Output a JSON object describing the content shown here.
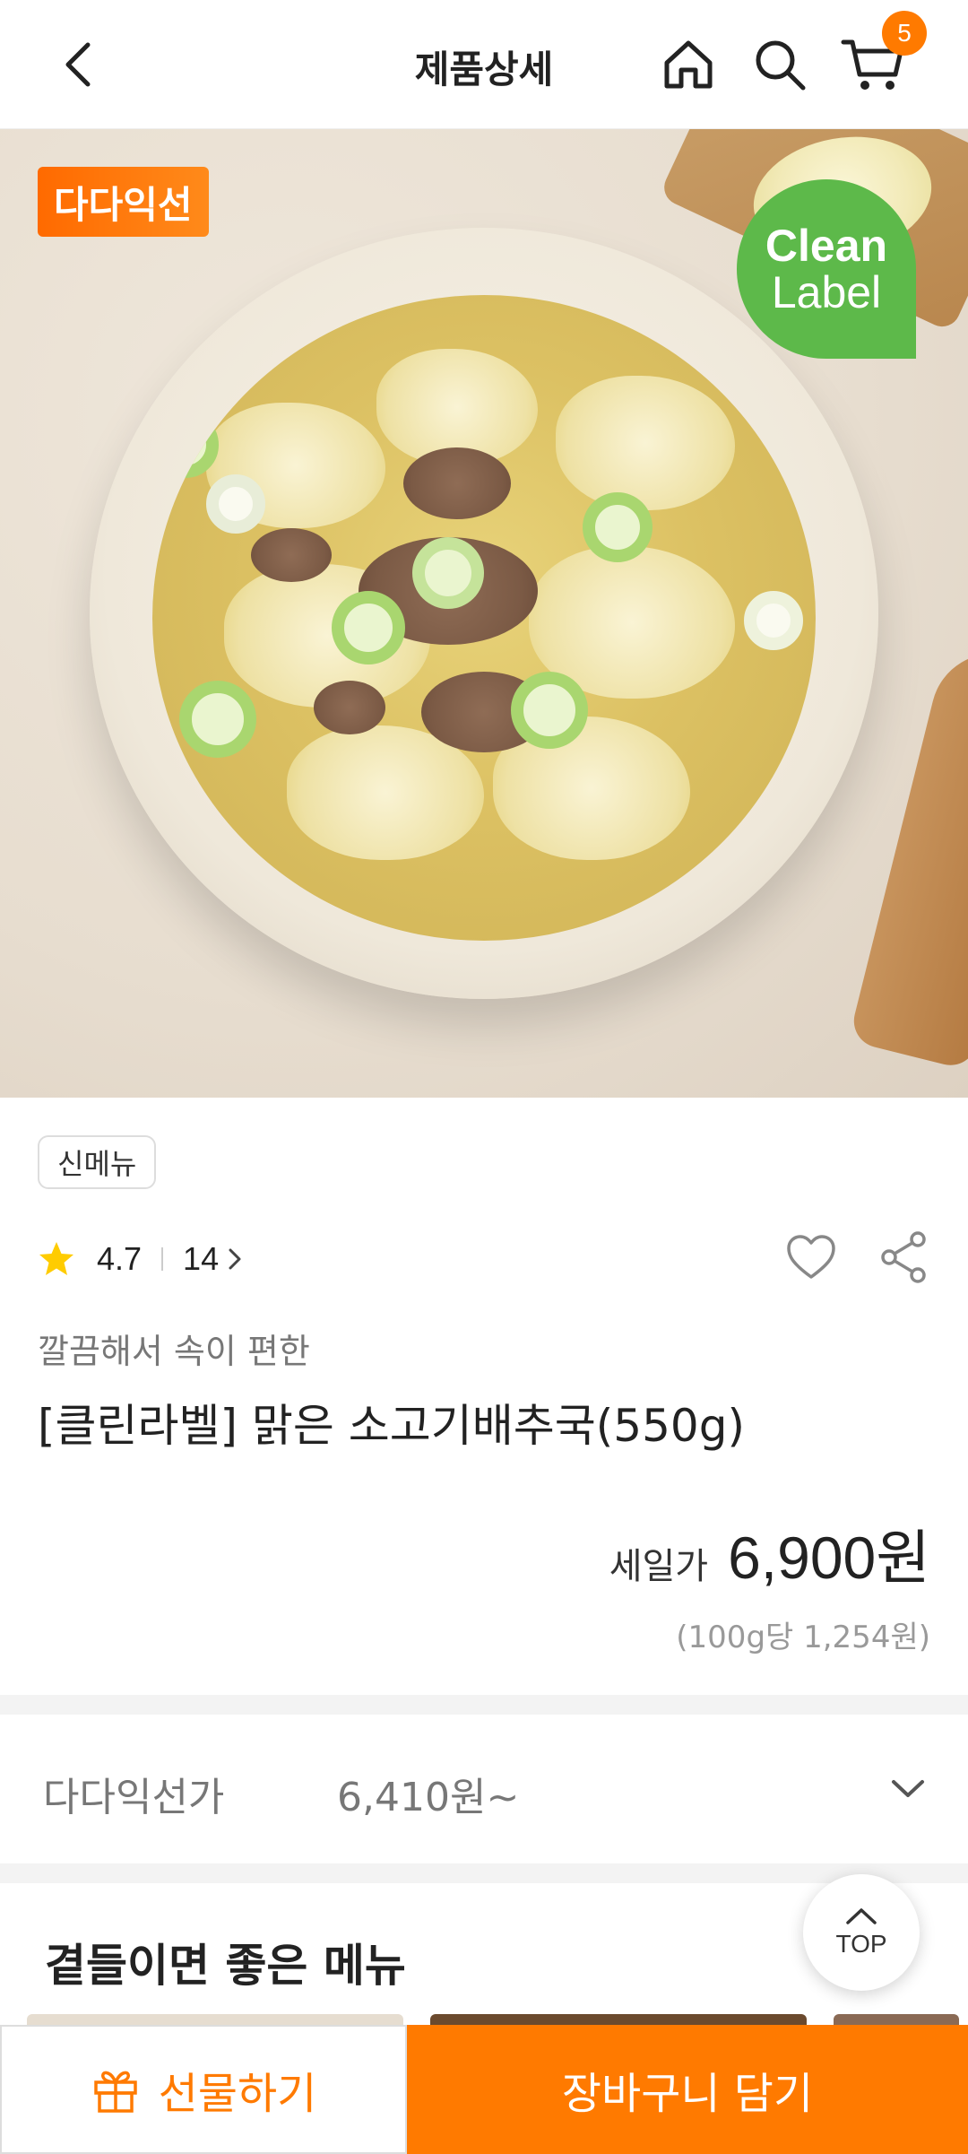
{
  "header": {
    "title": "제품상세",
    "cart_count": "5"
  },
  "hero": {
    "badge": "다다익선",
    "clean_label_line1": "Clean",
    "clean_label_line2": "Label"
  },
  "product": {
    "tag": "신메뉴",
    "rating": "4.7",
    "review_count": "14",
    "subtitle": "깔끔해서 속이 편한",
    "name": "[클린라벨] 맑은 소고기배추국(550g)",
    "price_label": "세일가",
    "price": "6,900",
    "price_currency": "원",
    "unit_price": "(100g당 1,254원)"
  },
  "member_price": {
    "label": "다다익선가",
    "price": "6,410원~"
  },
  "recommend": {
    "title": "곁들이면 좋은 메뉴"
  },
  "top_button": {
    "label": "TOP"
  },
  "bottom_bar": {
    "gift_label": "선물하기",
    "cart_label": "장바구니 담기"
  },
  "colors": {
    "accent": "#ff7a00",
    "clean_green": "#5db94a",
    "star": "#ffcc00"
  }
}
